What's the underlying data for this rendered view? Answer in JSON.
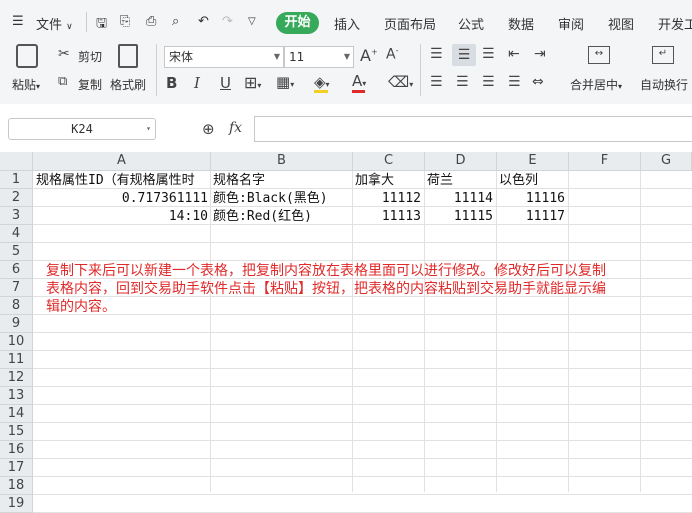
{
  "menu": {
    "file_label": "文件",
    "tabs": [
      "开始",
      "插入",
      "页面布局",
      "公式",
      "数据",
      "审阅",
      "视图",
      "开发工"
    ]
  },
  "ribbon": {
    "paste": "粘贴",
    "cut": "剪切",
    "copy": "复制",
    "format_painter": "格式刷",
    "font_name": "宋体",
    "font_size": "11",
    "merge_center": "合并居中",
    "wrap_text": "自动换行"
  },
  "formula_bar": {
    "name_box": "K24",
    "fx_label": "fx",
    "value": ""
  },
  "sheet": {
    "columns": [
      "A",
      "B",
      "C",
      "D",
      "E",
      "F",
      "G"
    ],
    "rows": [
      "1",
      "2",
      "3",
      "4",
      "5",
      "6",
      "7",
      "8",
      "9",
      "10",
      "11",
      "12",
      "13",
      "14",
      "15",
      "16",
      "17",
      "18",
      "19"
    ],
    "cells": {
      "A1": "规格属性ID（有规格属性时",
      "B1": "规格名字",
      "C1": "加拿大",
      "D1": "荷兰",
      "E1": "以色列",
      "A2": "0.717361111",
      "B2": "颜色:Black(黑色)",
      "C2": "11112",
      "D2": "11114",
      "E2": "11116",
      "A3": "14:10",
      "B3": "颜色:Red(红色)",
      "C3": "11113",
      "D3": "11115",
      "E3": "11117"
    },
    "note_lines": [
      "复制下来后可以新建一个表格，把复制内容放在表格里面可以进行修改。修改好后可以复制",
      "表格内容，回到交易助手软件点击【粘贴】按钮，把表格的内容粘贴到交易助手就能显示编",
      "辑的内容。"
    ]
  },
  "colors": {
    "accent": "#36a95a",
    "note_text": "#e02a2a",
    "header_bg": "#e9ecef"
  }
}
